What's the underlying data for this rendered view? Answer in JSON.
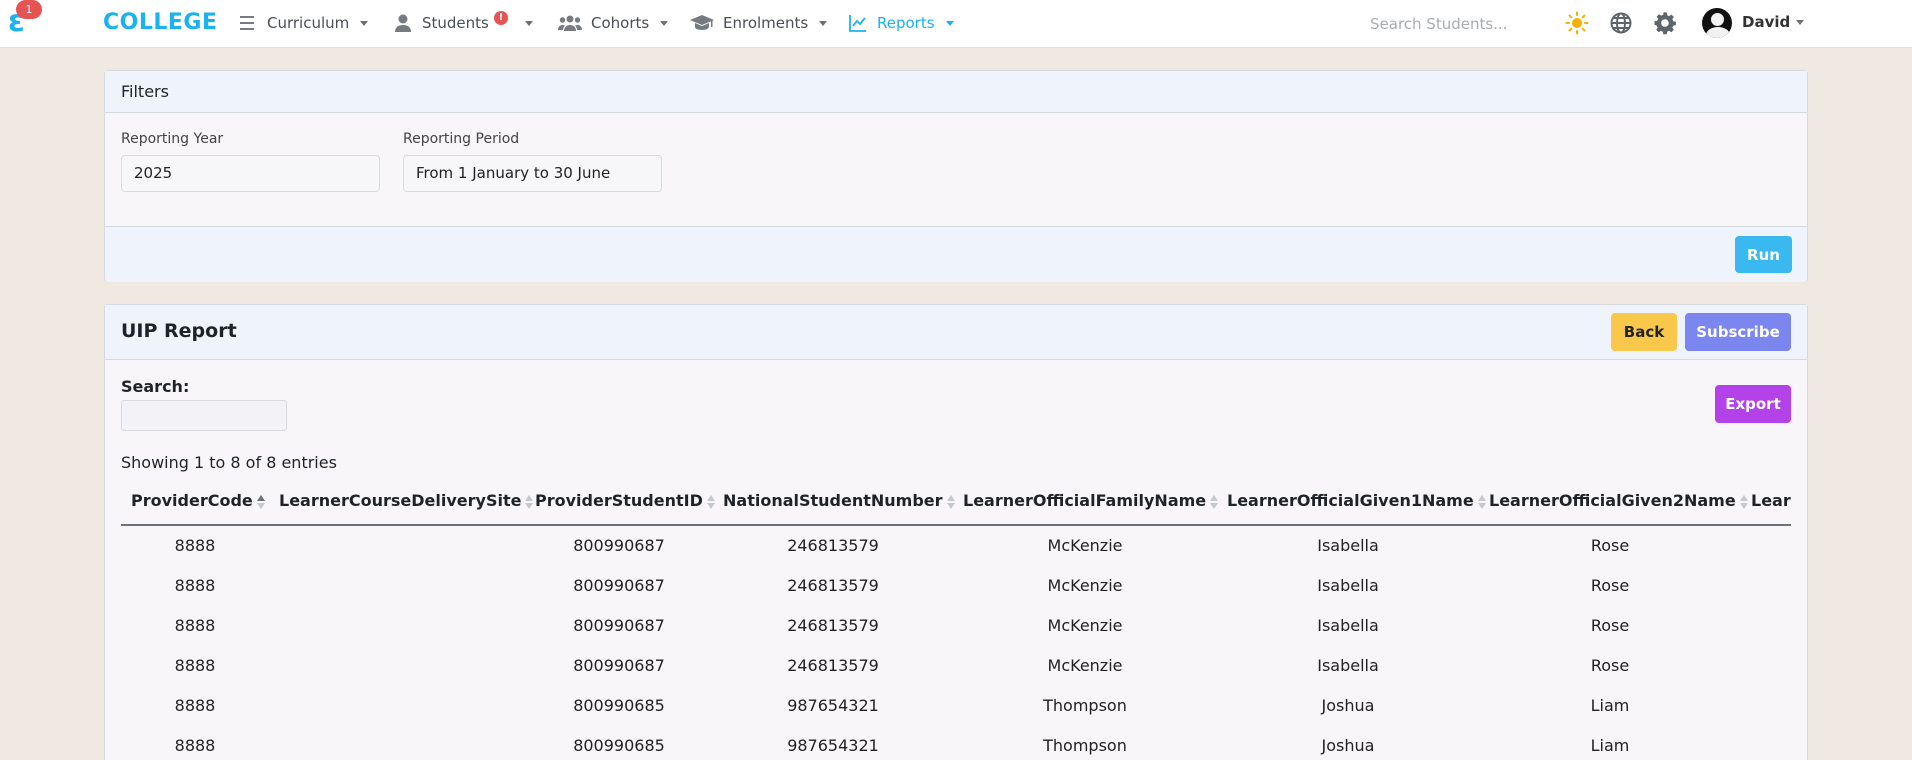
{
  "nav": {
    "badge": "1",
    "brand": "COLLEGE",
    "items": [
      {
        "label": "Curriculum",
        "icon": "menu-lines-icon"
      },
      {
        "label": "Students",
        "icon": "user-icon",
        "alert": "!"
      },
      {
        "label": "Cohorts",
        "icon": "users-group-icon"
      },
      {
        "label": "Enrolments",
        "icon": "graduation-cap-icon"
      },
      {
        "label": "Reports",
        "icon": "line-chart-icon",
        "active": true
      }
    ],
    "search_placeholder": "Search Students...",
    "user": "David",
    "colors": {
      "accent": "#1ab2f0",
      "sun": "#f5b100"
    }
  },
  "filters": {
    "title": "Filters",
    "year_label": "Reporting Year",
    "year_value": "2025",
    "period_label": "Reporting Period",
    "period_value": "From 1 January to 30 June",
    "run_label": "Run"
  },
  "report": {
    "title": "UIP Report",
    "back_label": "Back",
    "subscribe_label": "Subscribe",
    "export_label": "Export",
    "search_label": "Search:",
    "entries_info": "Showing 1 to 8 of 8 entries",
    "columns": [
      "ProviderCode",
      "LearnerCourseDeliverySite",
      "ProviderStudentID",
      "NationalStudentNumber",
      "LearnerOfficialFamilyName",
      "LearnerOfficialGiven1Name",
      "LearnerOfficialGiven2Name",
      "Learr"
    ],
    "rows": [
      [
        "8888",
        "",
        "800990687",
        "246813579",
        "McKenzie",
        "Isabella",
        "Rose",
        ""
      ],
      [
        "8888",
        "",
        "800990687",
        "246813579",
        "McKenzie",
        "Isabella",
        "Rose",
        ""
      ],
      [
        "8888",
        "",
        "800990687",
        "246813579",
        "McKenzie",
        "Isabella",
        "Rose",
        ""
      ],
      [
        "8888",
        "",
        "800990687",
        "246813579",
        "McKenzie",
        "Isabella",
        "Rose",
        ""
      ],
      [
        "8888",
        "",
        "800990685",
        "987654321",
        "Thompson",
        "Joshua",
        "Liam",
        ""
      ],
      [
        "8888",
        "",
        "800990685",
        "987654321",
        "Thompson",
        "Joshua",
        "Liam",
        ""
      ]
    ]
  }
}
